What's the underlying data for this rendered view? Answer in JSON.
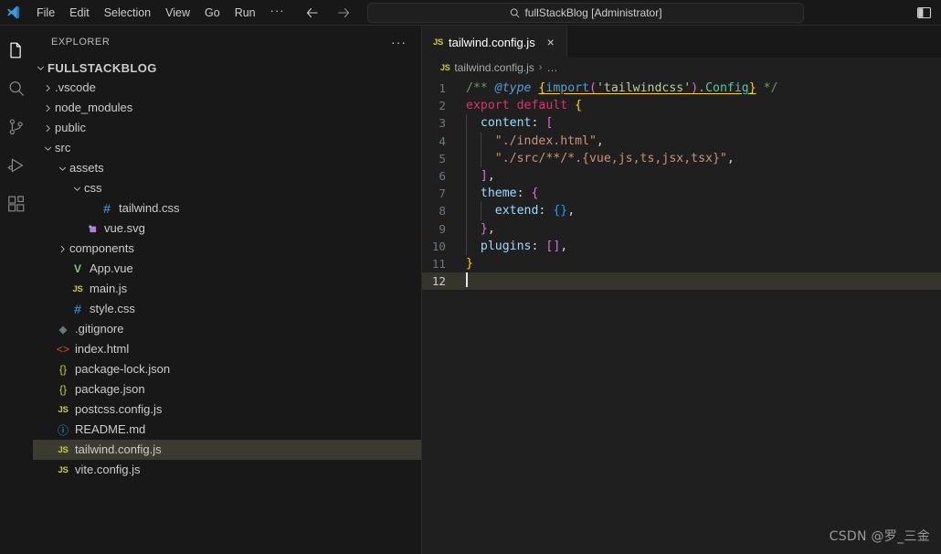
{
  "window": {
    "search_value": "fullStackBlog [Administrator]",
    "logo_icon": "vscode-logo"
  },
  "menu": {
    "items": [
      {
        "label": "File"
      },
      {
        "label": "Edit"
      },
      {
        "label": "Selection"
      },
      {
        "label": "View"
      },
      {
        "label": "Go"
      },
      {
        "label": "Run"
      },
      {
        "label": "···"
      }
    ]
  },
  "nav": {
    "back_icon": "arrow-left-icon",
    "forward_icon": "arrow-right-icon"
  },
  "activitybar": {
    "items": [
      {
        "name": "explorer",
        "icon": "files-icon",
        "active": true
      },
      {
        "name": "search",
        "icon": "search-icon",
        "active": false
      },
      {
        "name": "source-control",
        "icon": "source-control-icon",
        "active": false
      },
      {
        "name": "run-and-debug",
        "icon": "run-debug-icon",
        "active": false
      },
      {
        "name": "extensions",
        "icon": "extensions-icon",
        "active": false
      }
    ]
  },
  "sidebar": {
    "title": "EXPLORER",
    "actions_label": "···",
    "root": {
      "label": "FULLSTACKBLOG",
      "expanded": true
    },
    "tree": [
      {
        "label": ".vscode",
        "type": "folder",
        "depth": 1,
        "expanded": false
      },
      {
        "label": "node_modules",
        "type": "folder",
        "depth": 1,
        "expanded": false
      },
      {
        "label": "public",
        "type": "folder",
        "depth": 1,
        "expanded": false
      },
      {
        "label": "src",
        "type": "folder",
        "depth": 1,
        "expanded": true
      },
      {
        "label": "assets",
        "type": "folder",
        "depth": 2,
        "expanded": true
      },
      {
        "label": "css",
        "type": "folder",
        "depth": 3,
        "expanded": true
      },
      {
        "label": "tailwind.css",
        "type": "css",
        "depth": 4,
        "icon": "#"
      },
      {
        "label": "vue.svg",
        "type": "svg",
        "depth": 3,
        "icon": "svg-image-icon"
      },
      {
        "label": "components",
        "type": "folder",
        "depth": 2,
        "expanded": false
      },
      {
        "label": "App.vue",
        "type": "vue",
        "depth": 2,
        "icon": "V"
      },
      {
        "label": "main.js",
        "type": "js",
        "depth": 2,
        "icon": "JS"
      },
      {
        "label": "style.css",
        "type": "css",
        "depth": 2,
        "icon": "#"
      },
      {
        "label": ".gitignore",
        "type": "git",
        "depth": 1,
        "icon": "◈"
      },
      {
        "label": "index.html",
        "type": "html",
        "depth": 1,
        "icon": "<>"
      },
      {
        "label": "package-lock.json",
        "type": "json",
        "depth": 1,
        "icon": "{}"
      },
      {
        "label": "package.json",
        "type": "json",
        "depth": 1,
        "icon": "{}"
      },
      {
        "label": "postcss.config.js",
        "type": "js",
        "depth": 1,
        "icon": "JS"
      },
      {
        "label": "README.md",
        "type": "md",
        "depth": 1,
        "icon": "ⓘ"
      },
      {
        "label": "tailwind.config.js",
        "type": "js",
        "depth": 1,
        "icon": "JS",
        "selected": true
      },
      {
        "label": "vite.config.js",
        "type": "js",
        "depth": 1,
        "icon": "JS"
      }
    ]
  },
  "editor": {
    "tab": {
      "icon": "JS",
      "label": "tailwind.config.js",
      "close_icon": "×"
    },
    "breadcrumb": {
      "icon": "JS",
      "file": "tailwind.config.js",
      "separator": "›",
      "more": "…"
    },
    "line_numbers": [
      "1",
      "2",
      "3",
      "4",
      "5",
      "6",
      "7",
      "8",
      "9",
      "10",
      "11",
      "12"
    ],
    "current_line": 12,
    "lines": [
      "/** @type {import('tailwindcss').Config} */",
      "export default {",
      "  content: [",
      "    \"./index.html\",",
      "    \"./src/**/*.{vue,js,ts,jsx,tsx}\",",
      "  ],",
      "  theme: {",
      "    extend: {},",
      "  },",
      "  plugins: [],",
      "}",
      ""
    ],
    "code_tokens": {
      "l1": {
        "c1": "/** ",
        "tag": "@type",
        "sp": " ",
        "b1": "{",
        "fn": "import",
        "p1": "(",
        "str": "'tailwindcss'",
        "p2": ")",
        "dot": ".Config",
        "b2": "}",
        "c2": " */"
      },
      "l2": {
        "kw": "export default",
        "sp": " ",
        "brace": "{"
      },
      "l3": {
        "prop": "content",
        "colon": ":",
        "sp": " ",
        "bracket": "["
      },
      "l4": {
        "str": "\"./index.html\"",
        "comma": ","
      },
      "l5": {
        "str": "\"./src/**/*.{vue,js,ts,jsx,tsx}\"",
        "comma": ","
      },
      "l6": {
        "bracket": "]",
        "comma": ","
      },
      "l7": {
        "prop": "theme",
        "colon": ":",
        "sp": " ",
        "brace": "{"
      },
      "l8": {
        "prop": "extend",
        "colon": ":",
        "sp": " ",
        "b1": "{",
        "b2": "}",
        "comma": ","
      },
      "l9": {
        "brace": "}",
        "comma": ","
      },
      "l10": {
        "prop": "plugins",
        "colon": ":",
        "sp": " ",
        "b1": "[",
        "b2": "]",
        "comma": ","
      },
      "l11": {
        "brace": "}"
      }
    }
  },
  "watermark": {
    "text": "CSDN @罗_三金"
  },
  "colors": {
    "titlebar_bg": "#181818",
    "sidebar_bg": "#181818",
    "editor_bg": "#1f1f1f",
    "selected_row_bg": "#3b3b31",
    "current_line_bg": "#35352b",
    "accent_js": "#cbcb41",
    "string": "#ce9178",
    "keyword": "#d3396e",
    "property": "#9cdcfe",
    "comment": "#6a9955",
    "bracket_yellow": "#ffd700",
    "bracket_magenta": "#da70d6",
    "bracket_blue": "#179fff"
  }
}
